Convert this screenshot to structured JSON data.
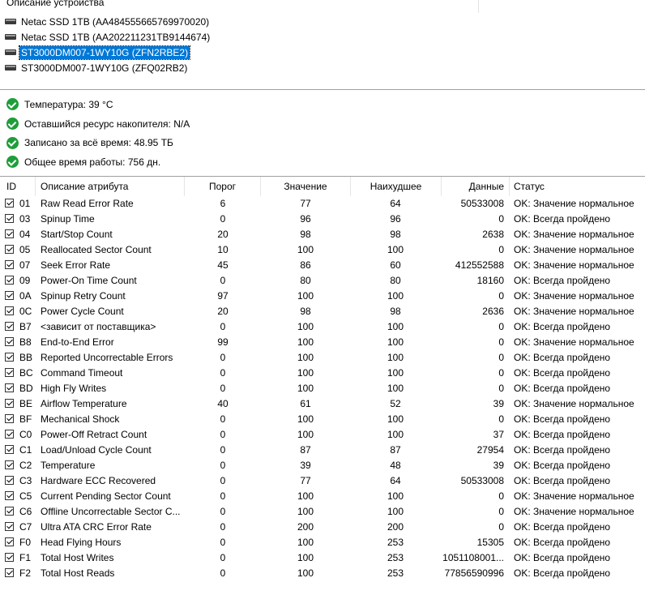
{
  "device_panel": {
    "header": "Описание устройства",
    "devices": [
      {
        "label": "Netac SSD 1TB (AA484555665769970020)",
        "selected": false
      },
      {
        "label": "Netac SSD 1TB (AA202211231TB9144674)",
        "selected": false
      },
      {
        "label": "ST3000DM007-1WY10G (ZFN2RBE2)",
        "selected": true
      },
      {
        "label": "ST3000DM007-1WY10G (ZFQ02RB2)",
        "selected": false
      }
    ]
  },
  "status": [
    {
      "icon": "ok-check-icon",
      "text": "Температура: 39 °C"
    },
    {
      "icon": "ok-check-icon",
      "text": "Оставшийся ресурс накопителя: N/A"
    },
    {
      "icon": "ok-check-icon",
      "text": "Записано за всё время: 48.95 ТБ"
    },
    {
      "icon": "ok-check-icon",
      "text": "Общее время работы: 756 дн."
    }
  ],
  "table": {
    "headers": {
      "id": "ID",
      "desc": "Описание атрибута",
      "threshold": "Порог",
      "value": "Значение",
      "worst": "Наихудшее",
      "data": "Данные",
      "status": "Статус"
    },
    "rows": [
      {
        "id": "01",
        "desc": "Raw Read Error Rate",
        "thr": "6",
        "val": "77",
        "worst": "64",
        "data": "50533008",
        "status": "OK: Значение нормальное"
      },
      {
        "id": "03",
        "desc": "Spinup Time",
        "thr": "0",
        "val": "96",
        "worst": "96",
        "data": "0",
        "status": "OK: Всегда пройдено"
      },
      {
        "id": "04",
        "desc": "Start/Stop Count",
        "thr": "20",
        "val": "98",
        "worst": "98",
        "data": "2638",
        "status": "OK: Значение нормальное"
      },
      {
        "id": "05",
        "desc": "Reallocated Sector Count",
        "thr": "10",
        "val": "100",
        "worst": "100",
        "data": "0",
        "status": "OK: Значение нормальное"
      },
      {
        "id": "07",
        "desc": "Seek Error Rate",
        "thr": "45",
        "val": "86",
        "worst": "60",
        "data": "412552588",
        "status": "OK: Значение нормальное"
      },
      {
        "id": "09",
        "desc": "Power-On Time Count",
        "thr": "0",
        "val": "80",
        "worst": "80",
        "data": "18160",
        "status": "OK: Всегда пройдено"
      },
      {
        "id": "0A",
        "desc": "Spinup Retry Count",
        "thr": "97",
        "val": "100",
        "worst": "100",
        "data": "0",
        "status": "OK: Значение нормальное"
      },
      {
        "id": "0C",
        "desc": "Power Cycle Count",
        "thr": "20",
        "val": "98",
        "worst": "98",
        "data": "2636",
        "status": "OK: Значение нормальное"
      },
      {
        "id": "B7",
        "desc": "<зависит от поставщика>",
        "thr": "0",
        "val": "100",
        "worst": "100",
        "data": "0",
        "status": "OK: Всегда пройдено"
      },
      {
        "id": "B8",
        "desc": "End-to-End Error",
        "thr": "99",
        "val": "100",
        "worst": "100",
        "data": "0",
        "status": "OK: Значение нормальное"
      },
      {
        "id": "BB",
        "desc": "Reported Uncorrectable Errors",
        "thr": "0",
        "val": "100",
        "worst": "100",
        "data": "0",
        "status": "OK: Всегда пройдено"
      },
      {
        "id": "BC",
        "desc": "Command Timeout",
        "thr": "0",
        "val": "100",
        "worst": "100",
        "data": "0",
        "status": "OK: Всегда пройдено"
      },
      {
        "id": "BD",
        "desc": "High Fly Writes",
        "thr": "0",
        "val": "100",
        "worst": "100",
        "data": "0",
        "status": "OK: Всегда пройдено"
      },
      {
        "id": "BE",
        "desc": "Airflow Temperature",
        "thr": "40",
        "val": "61",
        "worst": "52",
        "data": "39",
        "status": "OK: Значение нормальное"
      },
      {
        "id": "BF",
        "desc": "Mechanical Shock",
        "thr": "0",
        "val": "100",
        "worst": "100",
        "data": "0",
        "status": "OK: Всегда пройдено"
      },
      {
        "id": "C0",
        "desc": "Power-Off Retract Count",
        "thr": "0",
        "val": "100",
        "worst": "100",
        "data": "37",
        "status": "OK: Всегда пройдено"
      },
      {
        "id": "C1",
        "desc": "Load/Unload Cycle Count",
        "thr": "0",
        "val": "87",
        "worst": "87",
        "data": "27954",
        "status": "OK: Всегда пройдено"
      },
      {
        "id": "C2",
        "desc": "Temperature",
        "thr": "0",
        "val": "39",
        "worst": "48",
        "data": "39",
        "status": "OK: Всегда пройдено"
      },
      {
        "id": "C3",
        "desc": "Hardware ECC Recovered",
        "thr": "0",
        "val": "77",
        "worst": "64",
        "data": "50533008",
        "status": "OK: Всегда пройдено"
      },
      {
        "id": "C5",
        "desc": "Current Pending Sector Count",
        "thr": "0",
        "val": "100",
        "worst": "100",
        "data": "0",
        "status": "OK: Значение нормальное"
      },
      {
        "id": "C6",
        "desc": "Offline Uncorrectable Sector C...",
        "thr": "0",
        "val": "100",
        "worst": "100",
        "data": "0",
        "status": "OK: Значение нормальное"
      },
      {
        "id": "C7",
        "desc": "Ultra ATA CRC Error Rate",
        "thr": "0",
        "val": "200",
        "worst": "200",
        "data": "0",
        "status": "OK: Всегда пройдено"
      },
      {
        "id": "F0",
        "desc": "Head Flying Hours",
        "thr": "0",
        "val": "100",
        "worst": "253",
        "data": "15305",
        "status": "OK: Всегда пройдено"
      },
      {
        "id": "F1",
        "desc": "Total Host Writes",
        "thr": "0",
        "val": "100",
        "worst": "253",
        "data": "1051108001...",
        "status": "OK: Всегда пройдено"
      },
      {
        "id": "F2",
        "desc": "Total Host Reads",
        "thr": "0",
        "val": "100",
        "worst": "253",
        "data": "77856590996",
        "status": "OK: Всегда пройдено"
      }
    ]
  }
}
